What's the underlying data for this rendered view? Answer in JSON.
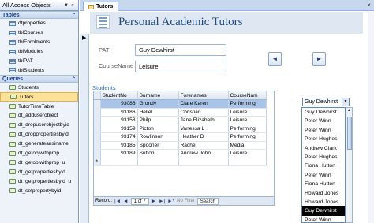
{
  "nav": {
    "title": "All Access Objects",
    "tables_header": "Tables",
    "tables": [
      "dtproperties",
      "tblCourses",
      "tblEnrolments",
      "tblModules",
      "tblPAT",
      "tblStudents"
    ],
    "queries_header": "Queries",
    "queries": [
      "Students",
      "Tutors",
      "TutorTimeTable",
      "dt_adduserobject",
      "dt_dropuserobjectbyid",
      "dt_droppropertiesbyid",
      "dt_generateansiname",
      "dt_getobjwithprop",
      "dt_getobjwithprop_u",
      "dt_getpropertiesbyid",
      "dt_getpropertiesbyid_u",
      "dt_setpropertybyid"
    ],
    "selected_query": "Tutors"
  },
  "document": {
    "tab_label": "Tutors",
    "title": "Personal Academic Tutors"
  },
  "form": {
    "pat_label": "PAT",
    "pat_value": "Guy Dewhirst",
    "course_label": "CourseName",
    "course_value": "Leisure",
    "prev_label": "◄",
    "next_label": "►"
  },
  "subform": {
    "label": "Students",
    "columns": [
      "StudentNo",
      "Surname",
      "Forenames",
      "CourseNam"
    ],
    "rows": [
      {
        "no": "93086",
        "surname": "Grundy",
        "forenames": "Clare Karen",
        "course": "Performing"
      },
      {
        "no": "93186",
        "surname": "Hellel",
        "forenames": "Christian",
        "course": "Leisure"
      },
      {
        "no": "93158",
        "surname": "Philp",
        "forenames": "Jane Elizabeth",
        "course": "Leisure"
      },
      {
        "no": "93159",
        "surname": "Picton",
        "forenames": "Vanessa L",
        "course": "Performing"
      },
      {
        "no": "93174",
        "surname": "Rowlinson",
        "forenames": "Heather D",
        "course": "Performing"
      },
      {
        "no": "93185",
        "surname": "Spooner",
        "forenames": "Rachel",
        "course": "Media"
      },
      {
        "no": "93189",
        "surname": "Sutton",
        "forenames": "Andrew John",
        "course": "Leisure"
      }
    ],
    "new_row_marker": "*",
    "record_label": "Record:",
    "record_position": "1 of 7",
    "filter_label": "No Filter",
    "search_label": "Search"
  },
  "combo": {
    "value": "Guy Dewhirst",
    "options": [
      "Guy Dewhirst",
      "Peter Winn",
      "Peter Winn",
      "Peter Hughes",
      "Andrew Clark",
      "Peter Hughes",
      "Fiona Hutton",
      "Peter Winn",
      "Fiona Hutton",
      "Howard Jones",
      "Howard Jones",
      "Guy Dewhirst",
      "Peter Winn",
      "Peter Winn"
    ],
    "selected_index": 11
  }
}
